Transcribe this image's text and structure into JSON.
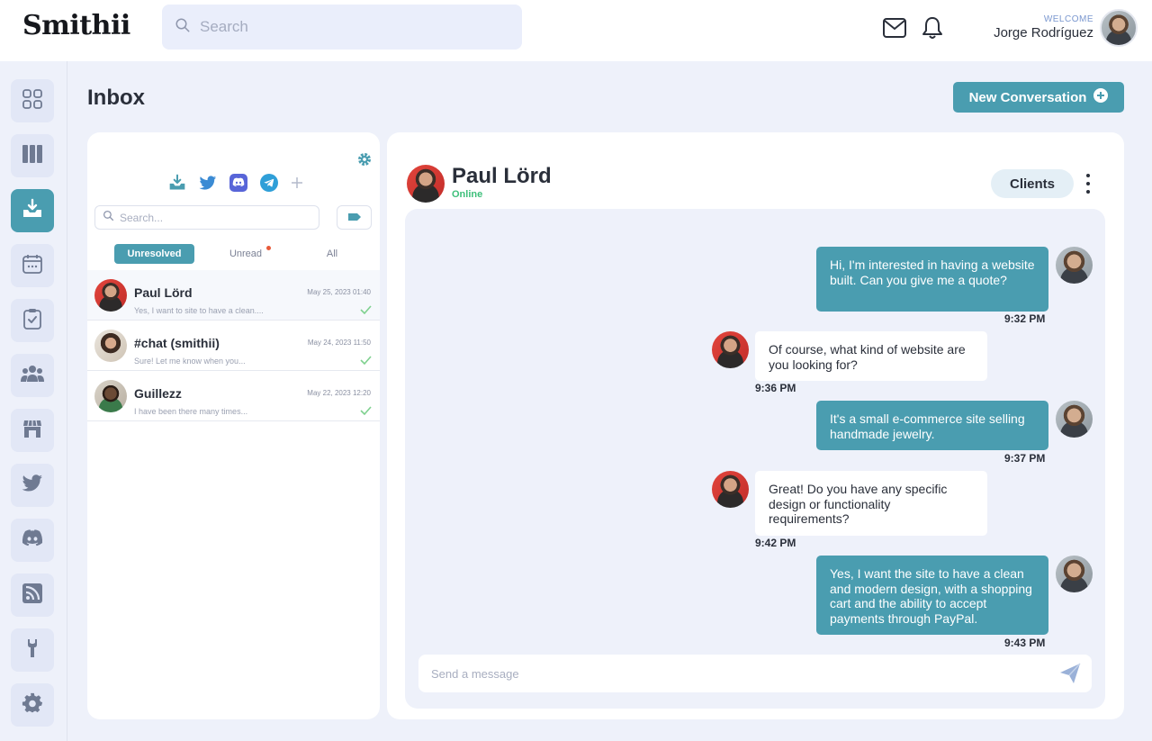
{
  "app": {
    "logo": "Smithii"
  },
  "header": {
    "search_placeholder": "Search",
    "welcome_label": "WELCOME",
    "user_name": "Jorge Rodríguez",
    "icons": [
      "mail-icon",
      "bell-icon"
    ]
  },
  "rail": {
    "items": [
      {
        "icon": "dashboard-grid-icon",
        "active": false
      },
      {
        "icon": "columns-icon",
        "active": false
      },
      {
        "icon": "inbox-icon",
        "active": true
      },
      {
        "icon": "calendar-icon",
        "active": false
      },
      {
        "icon": "clipboard-check-icon",
        "active": false
      },
      {
        "icon": "team-icon",
        "active": false
      },
      {
        "icon": "store-icon",
        "active": false
      },
      {
        "icon": "twitter-icon",
        "active": false
      },
      {
        "icon": "discord-icon",
        "active": false
      },
      {
        "icon": "rss-icon",
        "active": false
      },
      {
        "icon": "wrench-icon",
        "active": false
      },
      {
        "icon": "gear-icon",
        "active": false
      }
    ]
  },
  "page": {
    "title": "Inbox",
    "new_conversation_label": "New Conversation"
  },
  "list": {
    "channels": [
      "inbox-download-icon",
      "twitter-icon",
      "discord-icon",
      "telegram-icon",
      "plus-icon"
    ],
    "search_placeholder": "Search...",
    "filters": [
      {
        "label": "Unresolved",
        "active": true
      },
      {
        "label": "Unread",
        "active": false,
        "has_dot": true
      },
      {
        "label": "All",
        "active": false
      }
    ],
    "conversations": [
      {
        "name": "Paul Lörd",
        "date": "May 25, 2023 01:40",
        "preview": "Yes, I want to site to have a clean....",
        "read": true
      },
      {
        "name": "#chat (smithii)",
        "date": "May 24, 2023 11:50",
        "preview": "Sure! Let me know when you...",
        "read": true
      },
      {
        "name": "Guillezz",
        "date": "May 22, 2023 12:20",
        "preview": "I have been there many times...",
        "read": true
      }
    ]
  },
  "chat": {
    "contact_name": "Paul Lörd",
    "status": "Online",
    "tag_label": "Clients",
    "messages": [
      {
        "direction": "out",
        "text": "Hi, I'm interested in having a website built. Can you give me a quote?",
        "time": "9:32 PM"
      },
      {
        "direction": "in",
        "text": "Of course, what kind of website are you looking for?",
        "time": "9:36 PM"
      },
      {
        "direction": "out",
        "text": "It's a small e-commerce site selling handmade jewelry.",
        "time": "9:37 PM"
      },
      {
        "direction": "in",
        "text": "Great! Do you have any specific design or functionality requirements?",
        "time": "9:42 PM"
      },
      {
        "direction": "out",
        "text": "Yes, I want the site to have a clean and modern design, with a shopping cart and the ability to accept payments through PayPal.",
        "time": "9:43 PM"
      }
    ],
    "composer_placeholder": "Send a message"
  },
  "colors": {
    "accent": "#4a9db0",
    "background": "#eef1fa",
    "online": "#3dbf7a",
    "unread_dot": "#e85a3a"
  }
}
